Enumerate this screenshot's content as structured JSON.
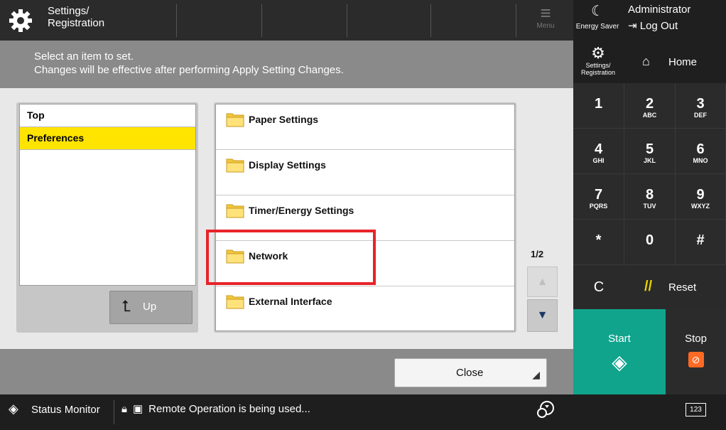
{
  "header": {
    "app_title_line1": "Settings/",
    "app_title_line2": "Registration",
    "menu_label": "Menu",
    "energy_saver_label": "Energy Saver",
    "user_name": "Administrator",
    "logout_label": "Log Out"
  },
  "instruction": {
    "line1": "Select an item to set.",
    "line2": "Changes will be effective after performing Apply Setting Changes."
  },
  "breadcrumb": {
    "items": [
      "Top",
      "Preferences"
    ],
    "selected": "Preferences",
    "up_label": "Up"
  },
  "settings_list": {
    "items": [
      "Paper Settings",
      "Display Settings",
      "Timer/Energy Settings",
      "Network",
      "External Interface"
    ],
    "page_indicator": "1/2"
  },
  "actions": {
    "close_label": "Close"
  },
  "status_bar": {
    "status_monitor_label": "Status Monitor",
    "remote_message": "Remote Operation is being used...",
    "keyboard_label": "123"
  },
  "keypad": {
    "settings_label_line1": "Settings/",
    "settings_label_line2": "Registration",
    "home_label": "Home",
    "keys": [
      {
        "n": "1",
        "s": ""
      },
      {
        "n": "2",
        "s": "ABC"
      },
      {
        "n": "3",
        "s": "DEF"
      },
      {
        "n": "4",
        "s": "GHI"
      },
      {
        "n": "5",
        "s": "JKL"
      },
      {
        "n": "6",
        "s": "MNO"
      },
      {
        "n": "7",
        "s": "PQRS"
      },
      {
        "n": "8",
        "s": "TUV"
      },
      {
        "n": "9",
        "s": "WXYZ"
      },
      {
        "n": "*",
        "s": ""
      },
      {
        "n": "0",
        "s": ""
      },
      {
        "n": "#",
        "s": ""
      }
    ],
    "clear_label": "C",
    "reset_label": "Reset",
    "start_label": "Start",
    "stop_label": "Stop"
  },
  "colors": {
    "selected_highlight": "#ffe400",
    "annotation_box": "#e8232a",
    "start_button": "#10a48d",
    "stop_icon": "#ff6a23"
  }
}
